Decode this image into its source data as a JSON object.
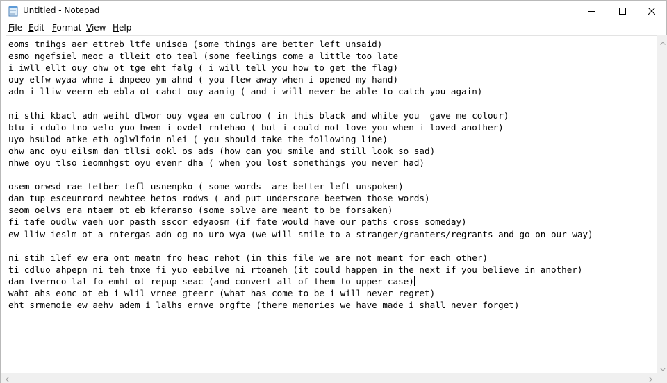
{
  "window": {
    "title": "Untitled - Notepad",
    "app_icon": "notepad-icon",
    "controls": {
      "minimize": "minimize-icon",
      "maximize": "maximize-icon",
      "close": "close-icon"
    }
  },
  "menu": [
    {
      "accel": "F",
      "rest": "ile"
    },
    {
      "accel": "E",
      "rest": "dit"
    },
    {
      "accel": "F",
      "rest": "ormat"
    },
    {
      "accel": "V",
      "rest": "iew"
    },
    {
      "accel": "H",
      "rest": "elp"
    }
  ],
  "editor": {
    "lines": [
      "eoms tnihgs aer ettreb ltfe unisda (some things are better left unsaid)",
      "esmo ngefsiel meoc a tlleit oto teal (some feelings come a little too late",
      "i iwll ellt ouy ohw ot tge eht falg ( i will tell you how to get the flag)",
      "ouy elfw wyaa whne i dnpeeo ym ahnd ( you flew away when i opened my hand)",
      "adn i lliw veern eb ebla ot cahct ouy aanig ( and i will never be able to catch you again)",
      "",
      "ni sthi kbacl adn weiht dlwor ouy vgea em culroo ( in this black and white you  gave me colour)",
      "btu i cdulo tno velo yuo hwen i ovdel rntehao ( but i could not love you when i loved another)",
      "uyo hsulod atke eth oglwlfoin nlei ( you should take the following line)",
      "ohw anc oyu eilsm dan tllsi ookl os ads (how can you smile and still look so sad)",
      "nhwe oyu tlso ieomnhgst oyu evenr dha ( when you lost somethings you never had)",
      "",
      "osem orwsd rae tetber tefl usnenpko ( some words  are better left unspoken)",
      "dan tup esceunrord newbtee hetos rodws ( and put underscore beetwen those words)",
      "seom oelvs era ntaem ot eb kferanso (some solve are meant to be forsaken)",
      "fi tafe oudlw vaeh uor pasth sscor edyaosm (if fate would have our paths cross someday)",
      "ew lliw ieslm ot a rntergas adn og no uro wya (we will smile to a stranger/granters/regrants and go on our way)",
      "",
      "ni stih ilef ew era ont meatn fro heac rehot (in this file we are not meant for each other)",
      "ti cdluo ahpepn ni teh tnxe fi yuo eebilve ni rtoaneh (it could happen in the next if you believe in another)",
      "dan tvernco lal fo emht ot repup seac (and convert all of them to upper case)",
      "waht ahs eomc ot eb i wlil vrnee gteerr (what has come to be i will never regret)",
      "eht srmemoie ew aehv adem i lalhs ernve orgfte (there memories we have made i shall never forget)"
    ],
    "caret_line": 20
  },
  "scrollbars": {
    "vertical": {
      "up": "chevron-up-icon",
      "down": "chevron-down-icon"
    },
    "horizontal": {
      "left": "chevron-left-icon",
      "right": "chevron-right-icon"
    }
  }
}
